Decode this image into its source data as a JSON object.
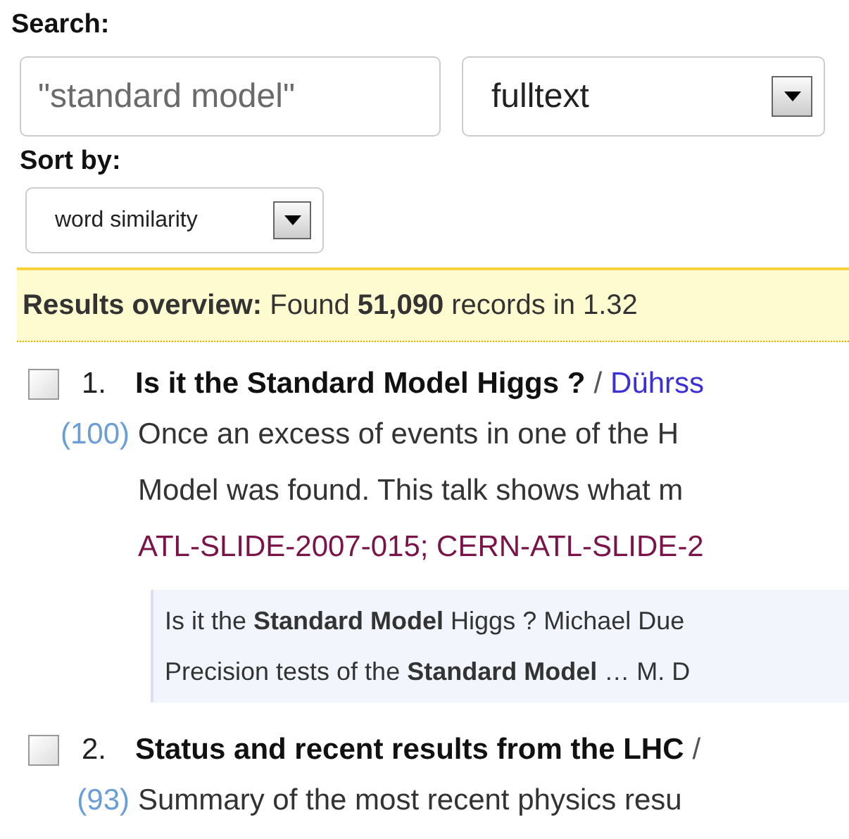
{
  "search": {
    "label": "Search:",
    "query": "\"standard model\"",
    "scope": "fulltext"
  },
  "sort": {
    "label": "Sort by:",
    "value": "word similarity"
  },
  "overview": "**Results overview:** Found **51,090** records in 1.32",
  "results": [
    {
      "checked": false,
      "number": "1.",
      "title": "Is it the Standard Model Higgs ?",
      "separator": "/",
      "authors": "Dührss",
      "score": "(100)",
      "abstract": [
        "Once an excess of events in one of the H",
        "Model was found. This talk shows what m"
      ],
      "report_numbers": "ATL-SLIDE-2007-015; CERN-ATL-SLIDE-2",
      "snippets": [
        "Is it the **Standard Model** Higgs ? Michael Due",
        "Precision tests of the **Standard Model** … M. D"
      ]
    },
    {
      "checked": false,
      "number": "2.",
      "title": "Status and recent results from the LHC",
      "separator": "/",
      "score": "(93)",
      "abstract": [
        "Summary of the most recent physics resu"
      ]
    }
  ]
}
